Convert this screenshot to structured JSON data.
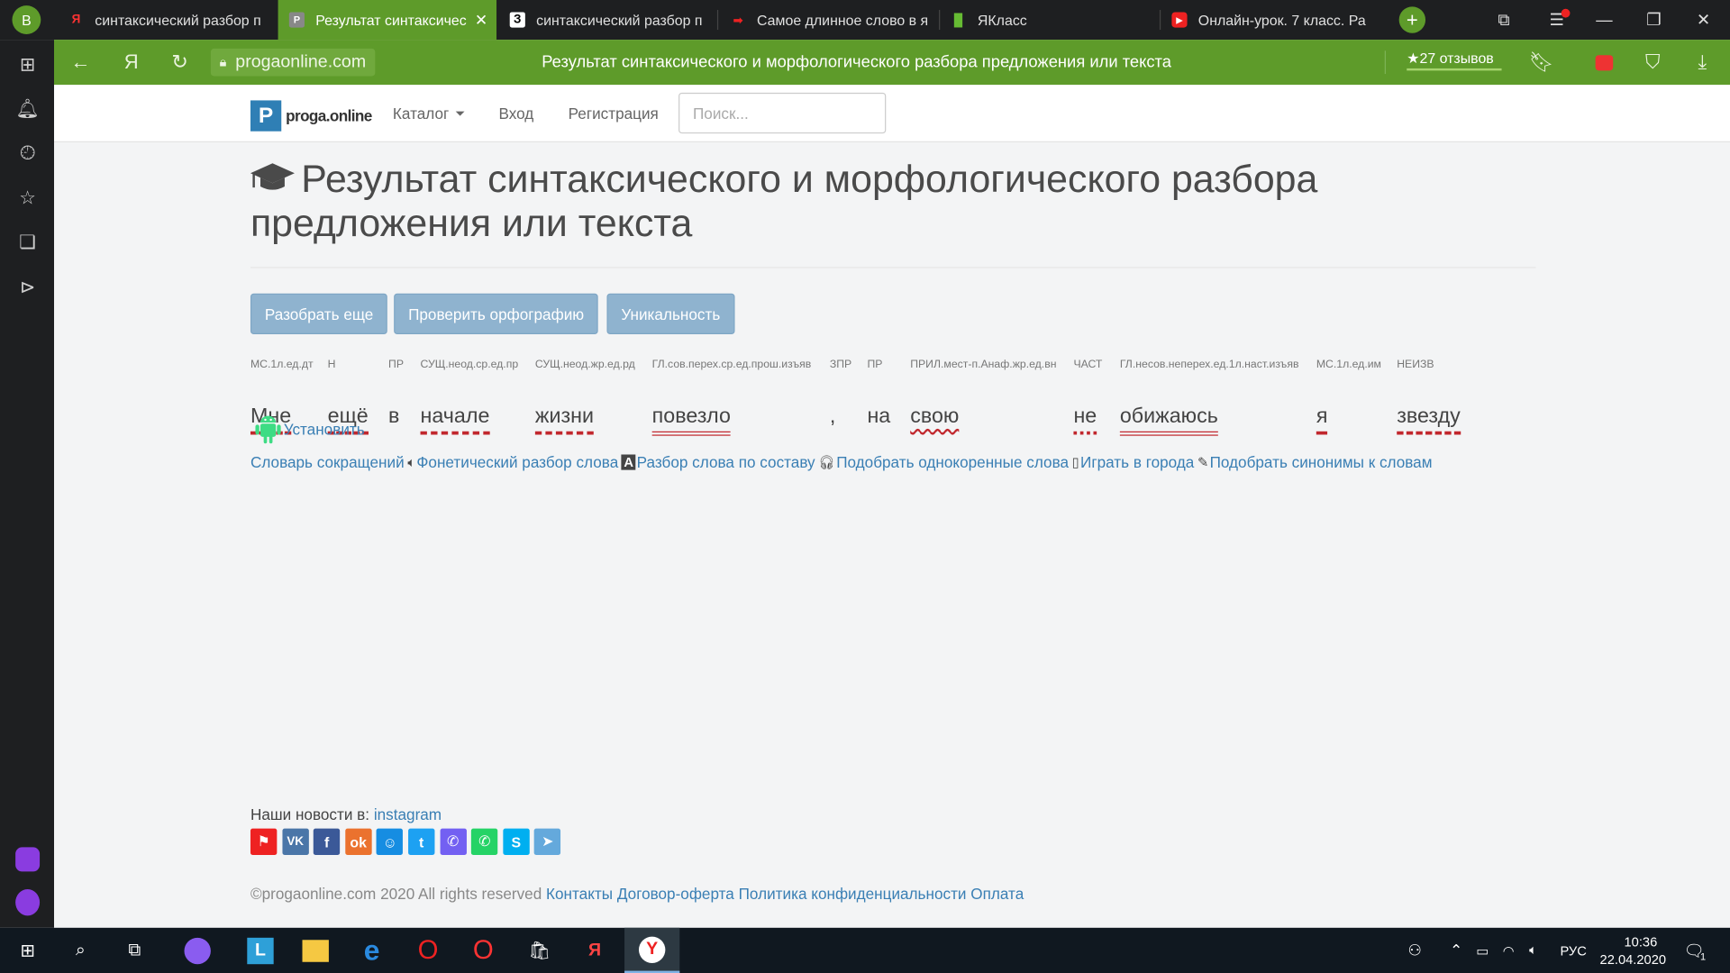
{
  "browser": {
    "profile_initial": "B",
    "tabs": [
      {
        "title": "синтаксический разбор п",
        "icon": "yandex-icon"
      },
      {
        "title": "Результат синтаксичес",
        "icon": "proga-favicon",
        "active": true
      },
      {
        "title": "синтаксический разбор п",
        "icon": "znanija-icon"
      },
      {
        "title": "Самое длинное слово в я",
        "icon": "arrow-favicon"
      },
      {
        "title": "ЯКласс",
        "icon": "yaklass-icon"
      },
      {
        "title": "Онлайн-урок. 7 класс. Ра",
        "icon": "youtube-icon"
      }
    ],
    "url": "progaonline.com",
    "page_title": "Результат синтаксического и морфологического разбора предложения или текста",
    "reviews": "★27 отзывов",
    "colors": {
      "accent": "#5e9b2a",
      "dark": "#1e1f21"
    }
  },
  "site": {
    "logo_letter": "P",
    "logo_text": "proga.online",
    "nav": {
      "catalog": "Каталог",
      "login": "Вход",
      "register": "Регистрация"
    },
    "search_placeholder": "Поиск...",
    "heading": "Результат синтаксического и морфологического разбора предложения или текста",
    "buttons": {
      "parse_again": "Разобрать еще",
      "spellcheck": "Проверить орфографию",
      "uniqueness": "Уникальность"
    },
    "words": [
      {
        "tag": "МС.1л.ед.дт",
        "word": "Мне",
        "underline": "dash"
      },
      {
        "tag": "Н",
        "word": "ещё",
        "underline": "dash"
      },
      {
        "tag": "ПР",
        "word": "в",
        "underline": "none"
      },
      {
        "tag": "СУЩ.неод.ср.ед.пр",
        "word": "начале",
        "underline": "dash"
      },
      {
        "tag": "СУЩ.неод.жр.ед.рд",
        "word": "жизни",
        "underline": "dash"
      },
      {
        "tag": "ГЛ.сов.перех.ср.ед.прош.изъяв",
        "word": "повезло",
        "underline": "double"
      },
      {
        "tag": "ЗПР",
        "word": ",",
        "underline": "none"
      },
      {
        "tag": "ПР",
        "word": "на",
        "underline": "none"
      },
      {
        "tag": "ПРИЛ.мест-п.Анаф.жр.ед.вн",
        "word": "свою",
        "underline": "wave"
      },
      {
        "tag": "ЧАСТ",
        "word": "не",
        "underline": "dot"
      },
      {
        "tag": "ГЛ.несов.неперех.ед.1л.наст.изъяв",
        "word": "обижаюсь",
        "underline": "double"
      },
      {
        "tag": "МС.1л.ед.им",
        "word": "я",
        "underline": "single"
      },
      {
        "tag": "НЕИЗВ",
        "word": "звезду",
        "underline": "dash"
      }
    ],
    "install": "Установить",
    "links": [
      {
        "text": "Словарь сокращений",
        "icon": "speaker-icon"
      },
      {
        "text": "Фонетический разбор слова",
        "icon": "font-icon"
      },
      {
        "text": "Разбор слова по составу",
        "icon": "headphones-icon"
      },
      {
        "text": "Подобрать однокоренные слова",
        "icon": "phone-icon"
      },
      {
        "text": "Играть в города",
        "icon": "edit-icon"
      },
      {
        "text": "Подобрать синонимы к словам",
        "icon": ""
      }
    ],
    "news_label": "Наши новости в:",
    "news_link": "instagram",
    "footer": {
      "copyright": "©progaonline.com 2020 All rights reserved",
      "contacts": "Контакты",
      "offer": "Договор-оферта",
      "privacy": "Политика конфиденциальности",
      "payment": "Оплата"
    }
  },
  "taskbar": {
    "lang": "РУС",
    "time": "10:36",
    "date": "22.04.2020",
    "notifications": "1"
  }
}
